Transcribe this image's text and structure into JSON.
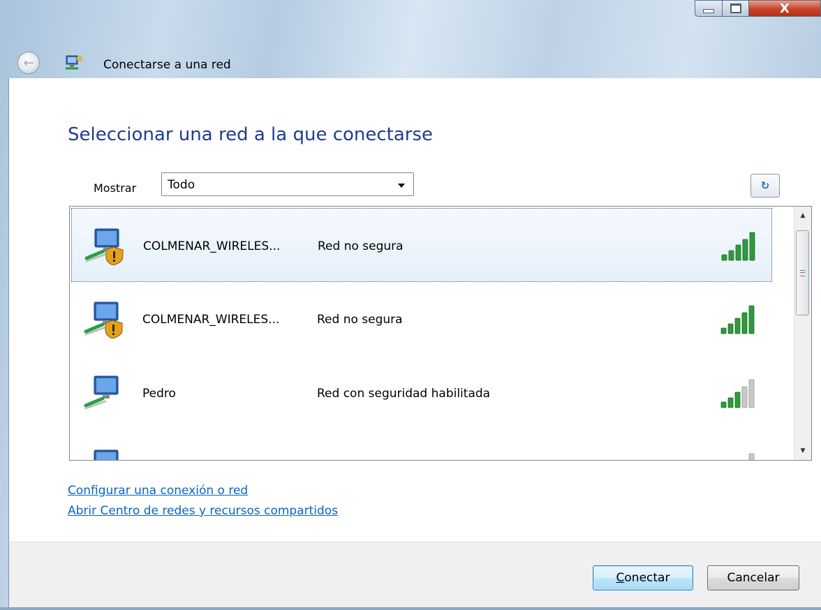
{
  "window": {
    "title": "Conectarse a una red",
    "controls": {
      "close_glyph": "X"
    }
  },
  "heading": "Seleccionar una red a la que conectarse",
  "filter": {
    "label": "Mostrar",
    "selected": "Todo"
  },
  "networks": [
    {
      "ssid": "COLMENAR_WIRELES...",
      "security": "Red no segura",
      "secure": false,
      "signal_bars": 5,
      "selected": true
    },
    {
      "ssid": "COLMENAR_WIRELES...",
      "security": "Red no segura",
      "secure": false,
      "signal_bars": 5,
      "selected": false
    },
    {
      "ssid": "Pedro",
      "security": "Red con seguridad habilitada",
      "secure": true,
      "signal_bars": 3,
      "selected": false
    },
    {
      "ssid": "",
      "security": "",
      "secure": true,
      "signal_bars": 1,
      "selected": false
    }
  ],
  "links": {
    "setup": "Configurar una conexión o red",
    "network_center": "Abrir Centro de redes y recursos compartidos"
  },
  "buttons": {
    "connect_mnemonic": "C",
    "connect_rest": "onectar",
    "cancel": "Cancelar"
  },
  "colors": {
    "heading": "#1e3d8f",
    "link": "#0a64c8",
    "signal_on": "#2e9a3c",
    "signal_off": "#c8c8c8"
  }
}
